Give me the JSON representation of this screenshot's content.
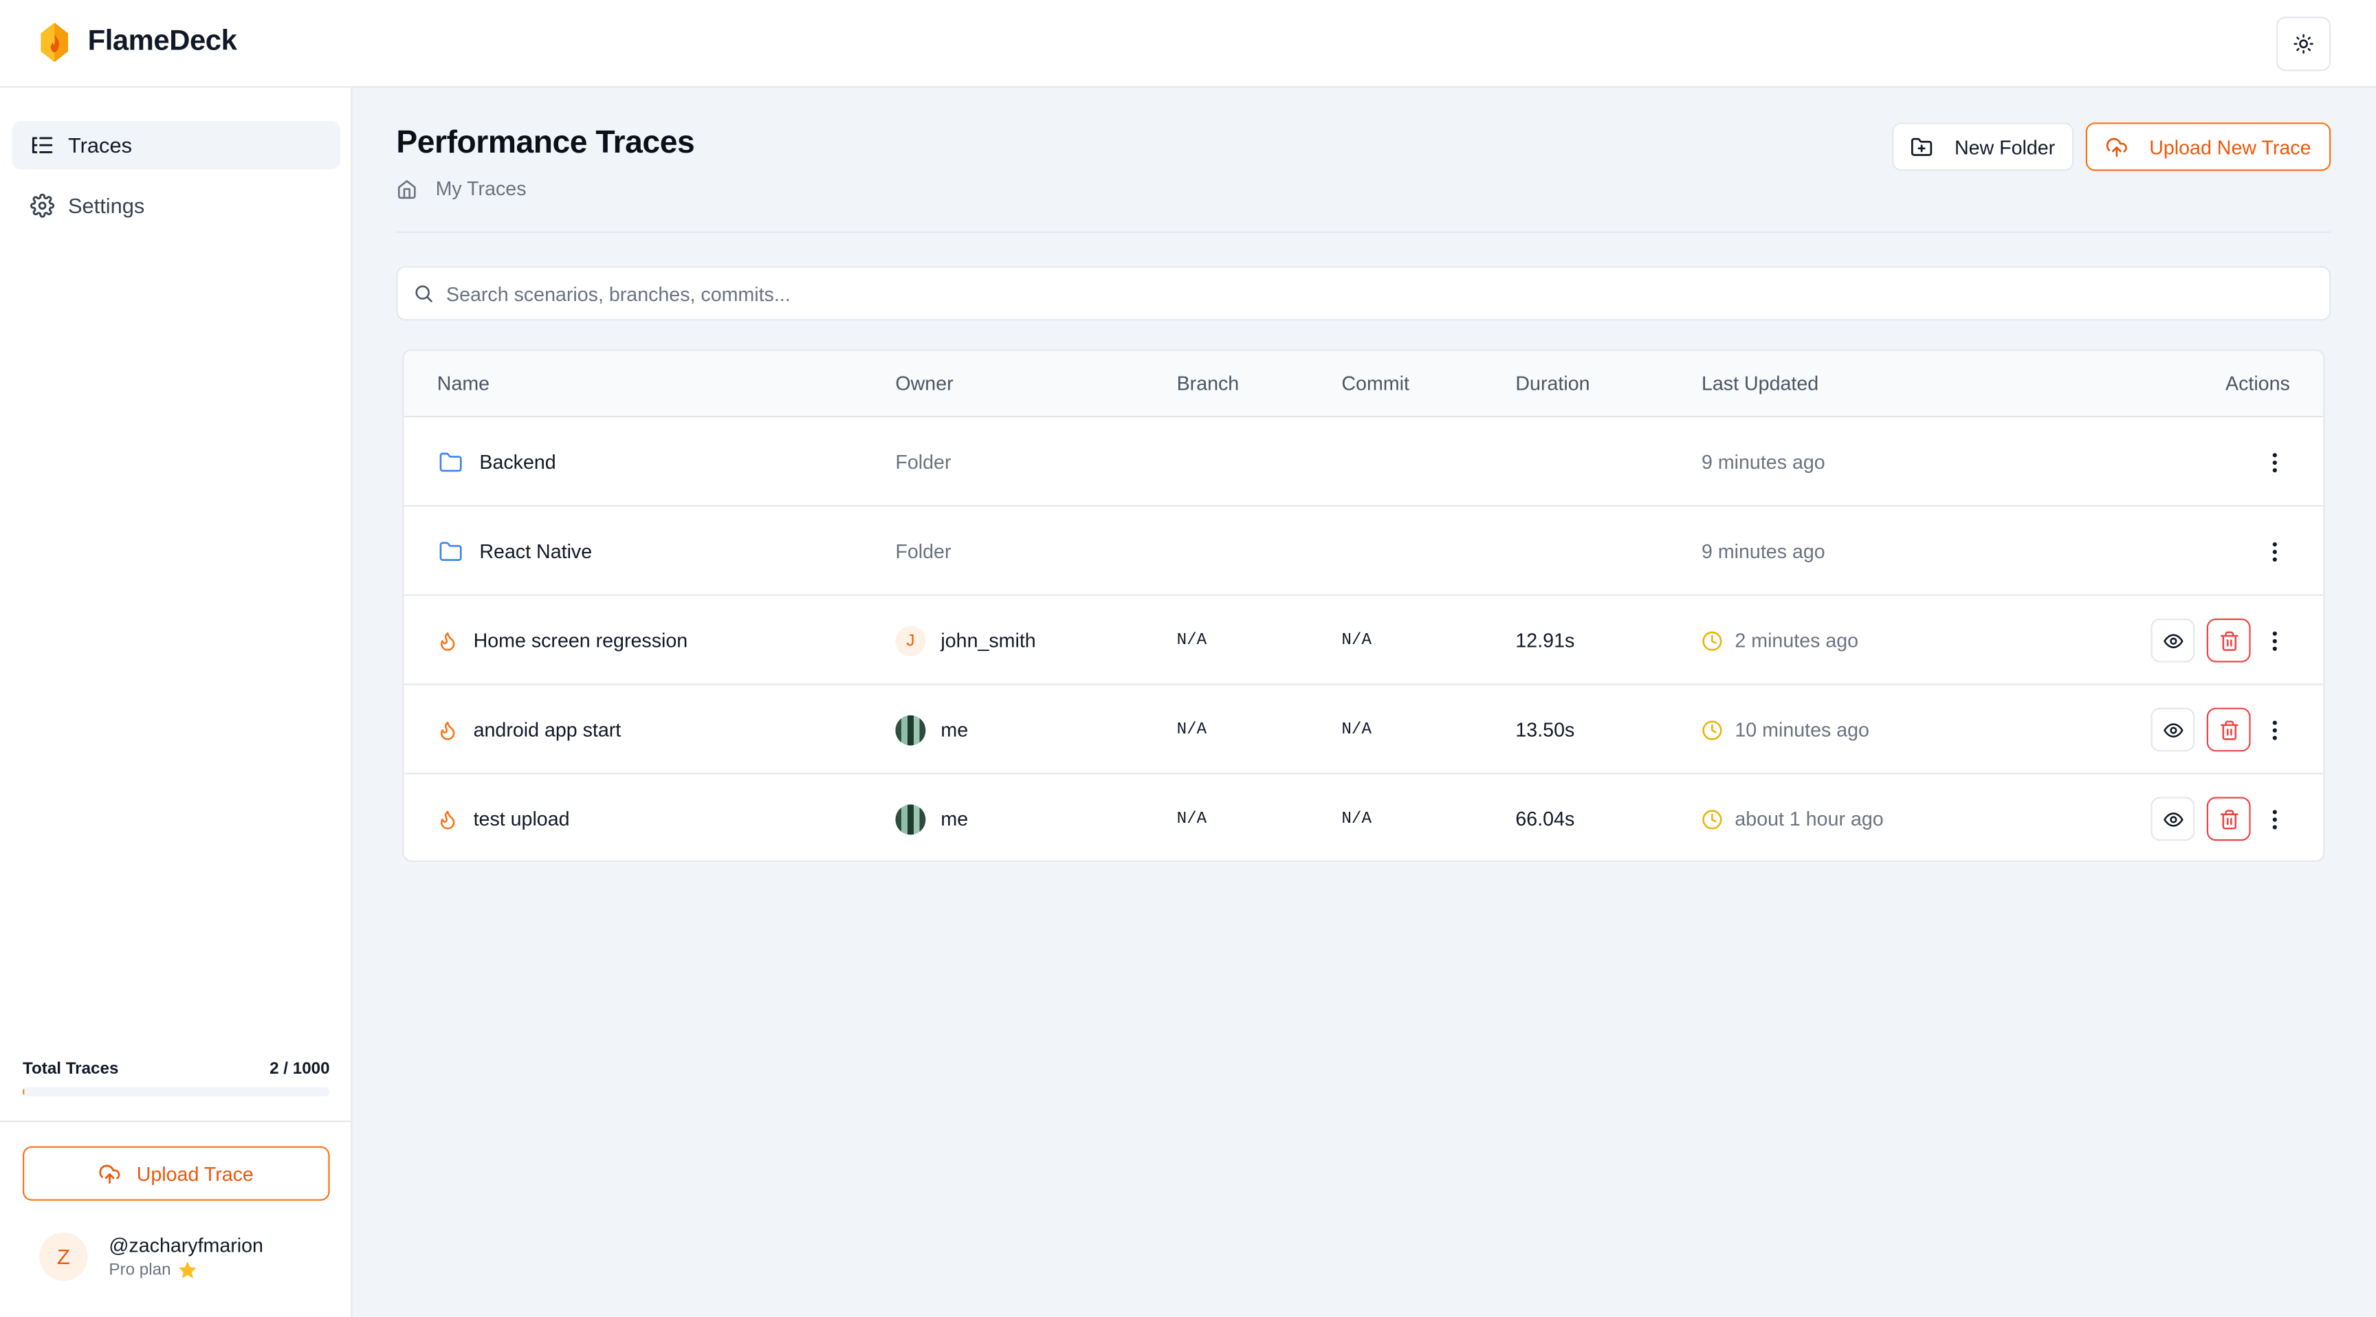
{
  "app": {
    "name": "FlameDeck"
  },
  "header": {
    "theme_toggle_icon": "sun-icon"
  },
  "sidebar": {
    "items": [
      {
        "label": "Traces",
        "icon": "list-tree-icon",
        "active": true
      },
      {
        "label": "Settings",
        "icon": "gear-icon",
        "active": false
      }
    ],
    "usage": {
      "label": "Total Traces",
      "count_text": "2 / 1000",
      "used": 2,
      "limit": 1000
    },
    "upload_label": "Upload Trace",
    "user": {
      "initial": "Z",
      "handle": "@zacharyfmarion",
      "plan": "Pro plan"
    }
  },
  "main": {
    "title": "Performance Traces",
    "breadcrumb": "My Traces",
    "new_folder_label": "New Folder",
    "upload_label": "Upload New Trace",
    "search_placeholder": "Search scenarios, branches, commits...",
    "columns": [
      "Name",
      "Owner",
      "Branch",
      "Commit",
      "Duration",
      "Last Updated",
      "Actions"
    ],
    "rows": [
      {
        "type": "folder",
        "name": "Backend",
        "owner": "Folder",
        "branch": "",
        "commit": "",
        "duration": "",
        "updated": "9 minutes ago"
      },
      {
        "type": "folder",
        "name": "React Native",
        "owner": "Folder",
        "branch": "",
        "commit": "",
        "duration": "",
        "updated": "9 minutes ago"
      },
      {
        "type": "trace",
        "name": "Home screen regression",
        "owner_initial": "J",
        "owner": "john_smith",
        "branch": "N/A",
        "commit": "N/A",
        "duration": "12.91s",
        "updated": "2 minutes ago"
      },
      {
        "type": "trace",
        "name": "android app start",
        "owner_initial": "",
        "owner": "me",
        "branch": "N/A",
        "commit": "N/A",
        "duration": "13.50s",
        "updated": "10 minutes ago"
      },
      {
        "type": "trace",
        "name": "test upload",
        "owner_initial": "",
        "owner": "me",
        "branch": "N/A",
        "commit": "N/A",
        "duration": "66.04s",
        "updated": "about 1 hour ago"
      }
    ]
  },
  "colors": {
    "accent": "#f97316",
    "folder": "#3b82f6",
    "danger": "#ef4444",
    "clock": "#eab308"
  }
}
